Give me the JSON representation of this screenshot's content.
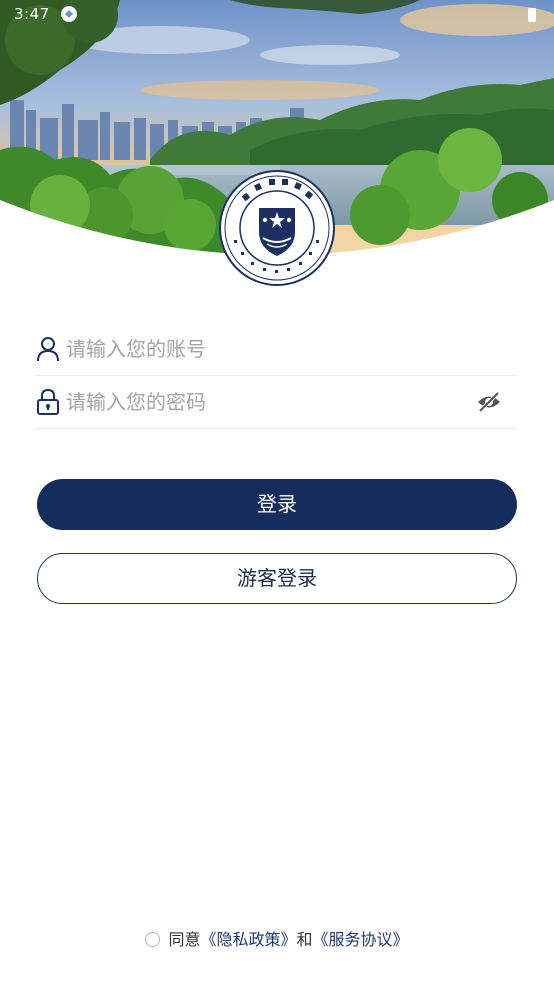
{
  "status_bar": {
    "time": "3:47"
  },
  "login": {
    "account_placeholder": "请输入您的账号",
    "password_placeholder": "请输入您的密码",
    "login_button": "登录",
    "guest_button": "游客登录"
  },
  "agreement": {
    "prefix": "同意",
    "privacy_link": "《隐私政策》",
    "joiner": "和",
    "service_link": "《服务协议》"
  },
  "colors": {
    "primary": "#152d5c",
    "link": "#1e3a6e",
    "placeholder": "#a4a4a4"
  },
  "icons": {
    "account": "person-icon",
    "password": "lock-icon",
    "visibility": "eye-off-icon",
    "logo": "college-emblem-logo"
  }
}
